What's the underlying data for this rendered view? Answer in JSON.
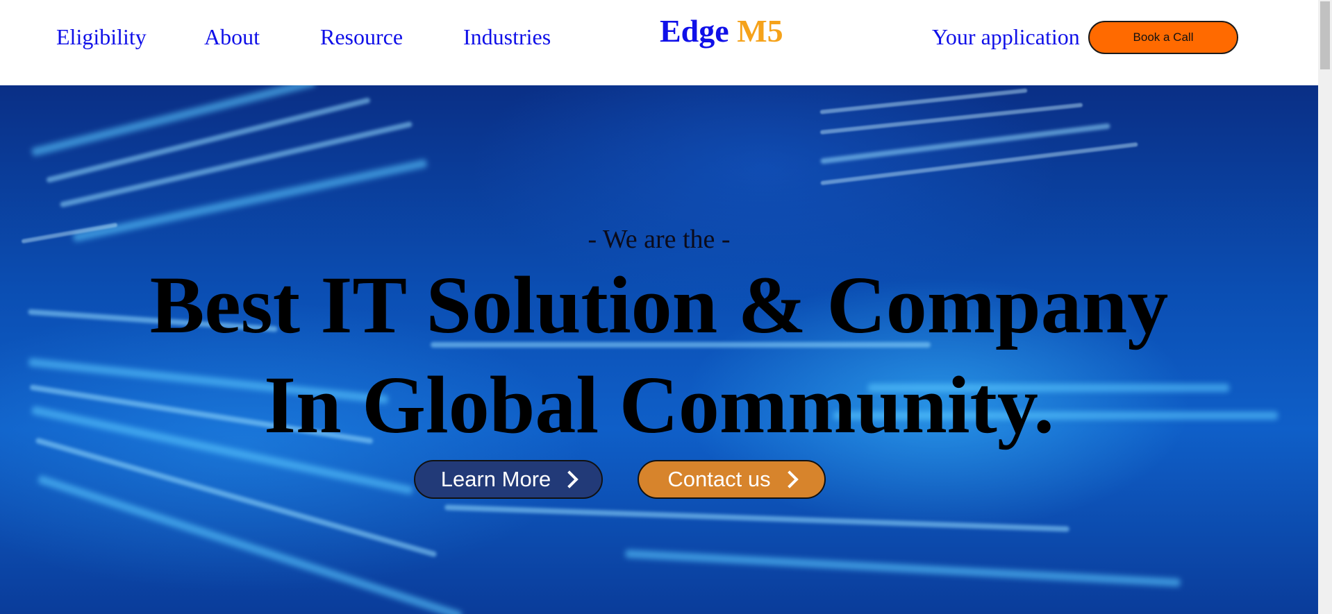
{
  "nav": {
    "links": [
      "Eligibility",
      "About",
      "Resource",
      "Industries"
    ],
    "right_link": "Your application",
    "book_button": "Book a Call"
  },
  "logo": {
    "part1": "Edge",
    "part2": "M5",
    "colors": {
      "part1": "#1010e8",
      "part2": "#f5a21a"
    }
  },
  "hero": {
    "subtitle": "- We are the -",
    "title_line1": "Best IT Solution & Company",
    "title_line2": "In Global Community.",
    "learn_more": "Learn More",
    "contact_us": "Contact us",
    "learn_more_icon": "chevron-right-icon",
    "contact_us_icon": "chevron-right-icon"
  },
  "colors": {
    "nav_link": "#1010e8",
    "book_button_bg": "#ff6a00",
    "learn_more_bg": "#223a78",
    "contact_us_bg": "#d7842c"
  }
}
